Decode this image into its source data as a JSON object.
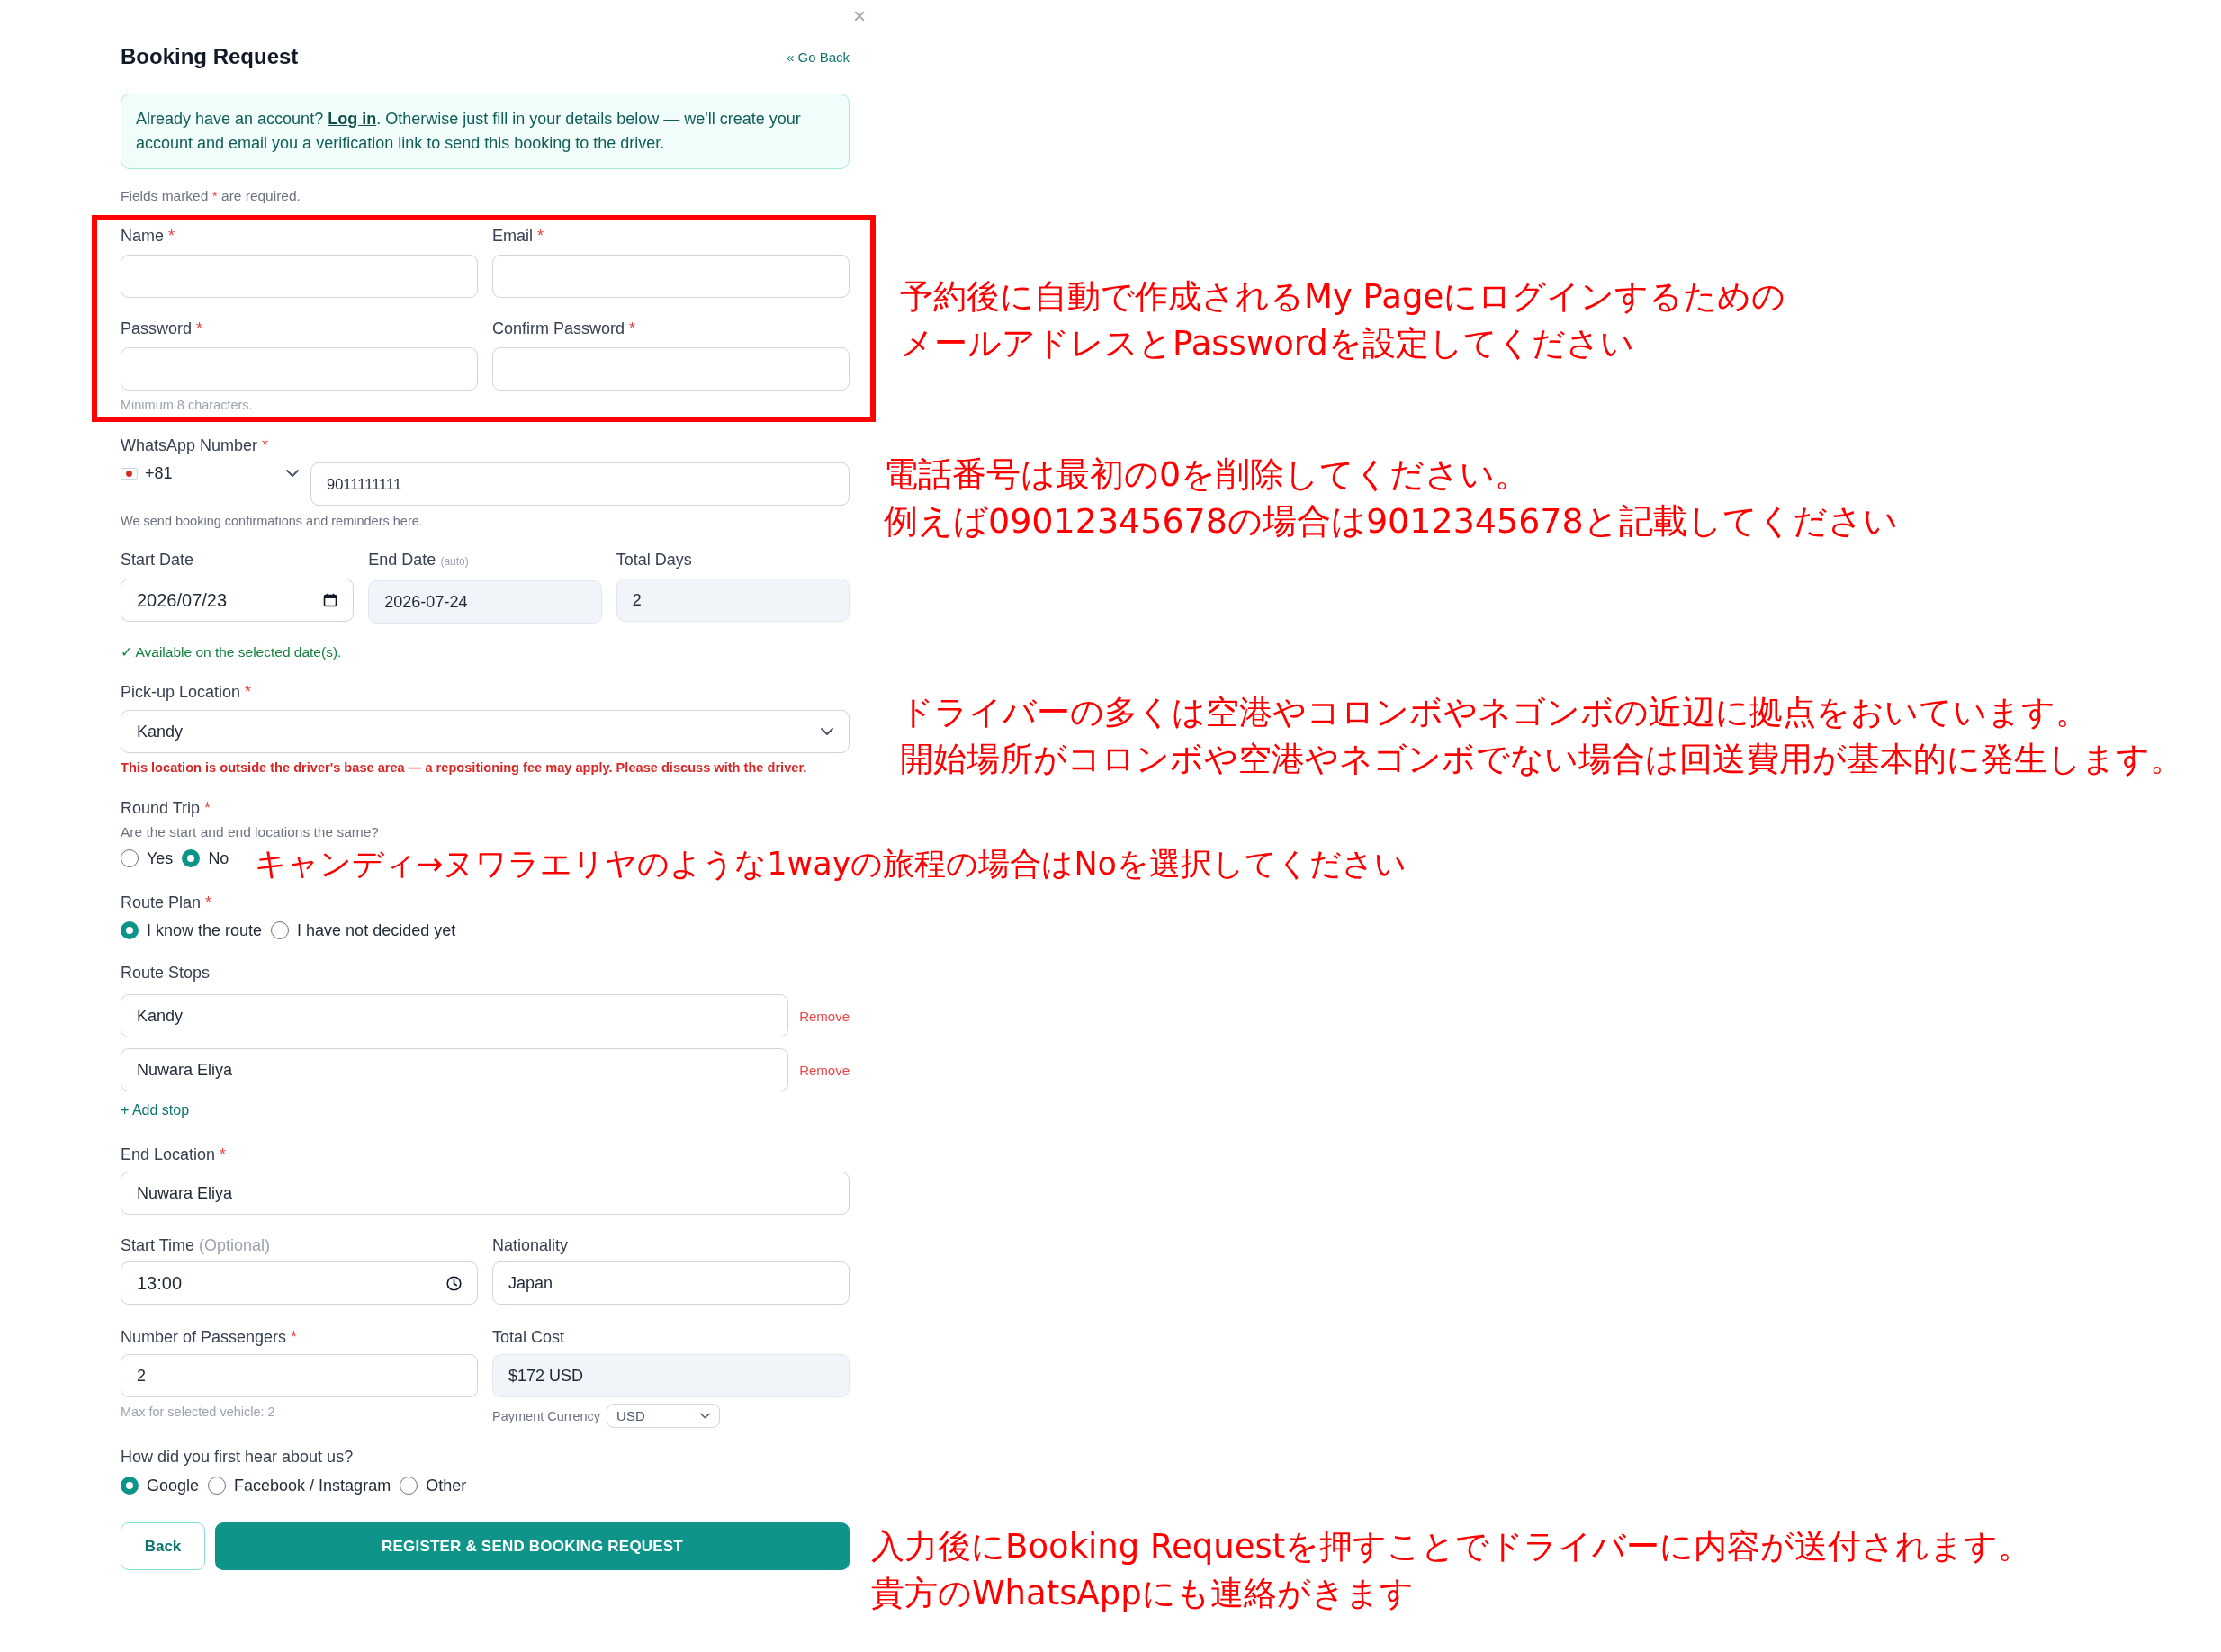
{
  "dialog": {
    "close": "×",
    "title": "Booking Request",
    "back_link": "« Go Back"
  },
  "notice": {
    "before": "Already have an account? ",
    "link": "Log in",
    "after": ". Otherwise just fill in your details below — we'll create your account and email you a verification link to send this booking to the driver."
  },
  "required_note": {
    "before": "Fields marked ",
    "mark": "*",
    "after": " are required."
  },
  "account_fields": [
    {
      "label": "Name",
      "required_mark": "*"
    },
    {
      "label": "Email",
      "required_mark": "*"
    },
    {
      "label": "Password",
      "required_mark": "*"
    },
    {
      "label": "Confirm Password",
      "required_mark": "*"
    }
  ],
  "password_hint": "Minimum 8 characters.",
  "whatsapp": {
    "label": "WhatsApp Number",
    "required_mark": "*",
    "country_code": "+81",
    "number": "9011111111",
    "hint": "We send booking confirmations and reminders here."
  },
  "dates": [
    {
      "label": "Start Date",
      "kind": "date",
      "value": "2026/07/23",
      "readonly": false
    },
    {
      "label": "End Date",
      "note": "(auto)",
      "kind": "text",
      "value": "2026-07-24",
      "readonly": true
    },
    {
      "label": "Total Days",
      "kind": "text",
      "value": "2",
      "readonly": true
    }
  ],
  "availability": "✓ Available on the selected date(s).",
  "pickup": {
    "label": "Pick-up Location",
    "required_mark": "*",
    "kind": "select",
    "value": "Kandy",
    "warning": "This location is outside the driver's base area — a repositioning fee may apply. Please discuss with the driver."
  },
  "round_trip": {
    "label": "Round Trip",
    "required_mark": "*",
    "question": "Are the start and end locations the same?",
    "options": [
      {
        "label": "Yes",
        "selected": false
      },
      {
        "label": "No",
        "selected": true
      }
    ]
  },
  "route_plan": {
    "label": "Route Plan",
    "required_mark": "*",
    "options": [
      {
        "label": "I know the route",
        "selected": true
      },
      {
        "label": "I have not decided yet",
        "selected": false
      }
    ]
  },
  "route_stops": {
    "label": "Route Stops",
    "stops": [
      {
        "value": "Kandy",
        "remove": "Remove"
      },
      {
        "value": "Nuwara Eliya",
        "remove": "Remove"
      }
    ],
    "add": "+ Add stop"
  },
  "end_location": {
    "label": "End Location",
    "required_mark": "*",
    "kind": "text",
    "value": "Nuwara Eliya"
  },
  "start_time": {
    "label": "Start Time",
    "note": "(Optional)",
    "kind": "time",
    "value": "13:00"
  },
  "nationality": {
    "label": "Nationality",
    "kind": "text",
    "value": "Japan"
  },
  "passengers": {
    "label": "Number of Passengers",
    "required_mark": "*",
    "kind": "text",
    "value": "2",
    "hint": "Max for selected vehicle: 2"
  },
  "total_cost": {
    "label": "Total Cost",
    "kind": "text",
    "value": "$172 USD",
    "readonly": true,
    "currency_label": "Payment Currency",
    "currency": "USD"
  },
  "referral": {
    "question": "How did you first hear about us?",
    "options": [
      {
        "label": "Google",
        "selected": true
      },
      {
        "label": "Facebook / Instagram",
        "selected": false
      },
      {
        "label": "Other",
        "selected": false
      }
    ]
  },
  "buttons": [
    {
      "label": "Back",
      "kind": "secondary"
    },
    {
      "label": "REGISTER & SEND BOOKING REQUEST",
      "kind": "primary"
    }
  ],
  "annotations": [
    {
      "lines": [
        "予約後に自動で作成されるMy Pageにログインするための",
        "メールアドレスとPasswordを設定してください"
      ]
    },
    {
      "lines": [
        "電話番号は最初の0を削除してください。",
        "例えば09012345678の場合は9012345678と記載してください"
      ]
    },
    {
      "lines": [
        "ドライバーの多くは空港やコロンボやネゴンボの近辺に拠点をおいています。",
        "開始場所がコロンボや空港やネゴンボでない場合は回送費用が基本的に発生します。"
      ]
    },
    {
      "lines": [
        "キャンディ→ヌワラエリヤのような1wayの旅程の場合はNoを選択してください"
      ]
    },
    {
      "lines": [
        "入力後にBooking Requestを押すことでドライバーに内容が送付されます。",
        "貴方のWhatsAppにも連絡がきます"
      ]
    }
  ]
}
